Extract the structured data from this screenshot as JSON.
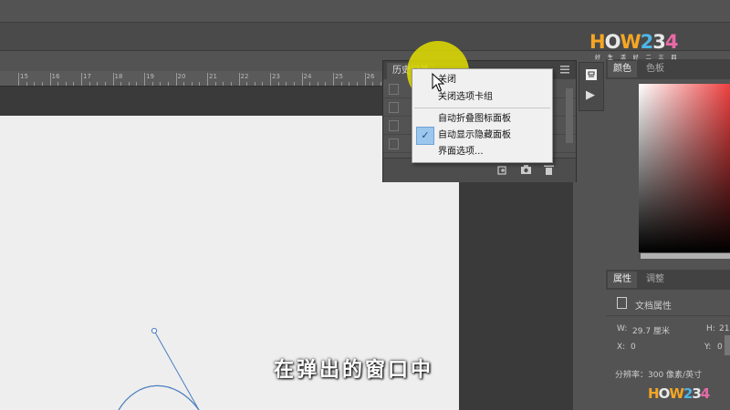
{
  "history_panel": {
    "tab_label": "历史记录",
    "row_count": 4
  },
  "context_menu": {
    "items": [
      "关闭",
      "关闭选项卡组",
      "自动折叠图标面板",
      "自动显示隐藏面板",
      "界面选项..."
    ],
    "checked_item": "自动显示隐藏面板"
  },
  "ruler": {
    "ticks": [
      "15",
      "16",
      "17",
      "18",
      "19",
      "20",
      "21",
      "22",
      "23",
      "24",
      "25",
      "26"
    ]
  },
  "color_panel": {
    "tabs": [
      "颜色",
      "色板"
    ]
  },
  "properties_panel": {
    "tabs": [
      "属性",
      "调整"
    ],
    "doc_label": "文档属性",
    "w_label": "W:",
    "w_value": "29.7 厘米",
    "h_label": "H:",
    "h_value": "21",
    "x_label": "X:",
    "x_value": "0",
    "y_label": "Y:",
    "y_value": "0",
    "resolution": "分辨率：300 像素/英寸"
  },
  "subtitle": "在弹出的窗口中",
  "watermark": {
    "logo": "HOW234",
    "tagline": "好 生 活 好 二 三 四"
  },
  "colors": {
    "ui_bg": "#535353",
    "canvas": "#eeeeee",
    "highlight": "#e2de00",
    "menu_bg": "#f0f0f0",
    "check_bg": "#9cc6ec",
    "path": "#4a7fbf"
  },
  "icons": {
    "checkmark": "✓",
    "play": "▶",
    "new_snapshot": "new-snapshot-icon",
    "camera": "camera-icon",
    "trash": "trash-icon"
  }
}
